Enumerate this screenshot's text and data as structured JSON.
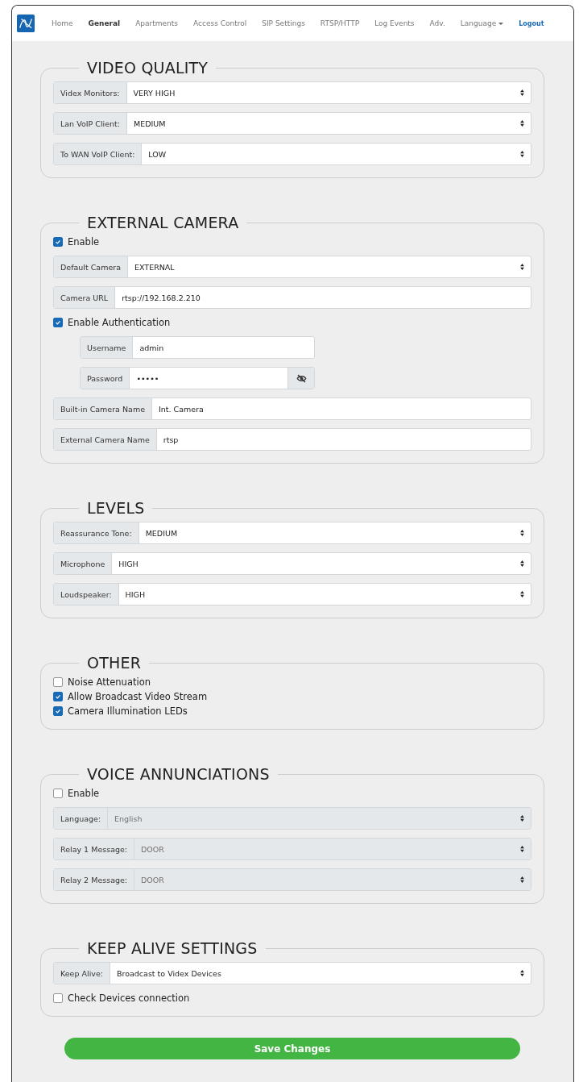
{
  "nav": {
    "items": [
      {
        "label": "Home",
        "selected": false,
        "kind": "link"
      },
      {
        "label": "General",
        "selected": true,
        "kind": "link"
      },
      {
        "label": "Apartments",
        "selected": false,
        "kind": "link"
      },
      {
        "label": "Access Control",
        "selected": false,
        "kind": "link"
      },
      {
        "label": "SIP Settings",
        "selected": false,
        "kind": "link"
      },
      {
        "label": "RTSP/HTTP",
        "selected": false,
        "kind": "link"
      },
      {
        "label": "Log Events",
        "selected": false,
        "kind": "link"
      },
      {
        "label": "Adv.",
        "selected": false,
        "kind": "link"
      },
      {
        "label": "Language",
        "selected": false,
        "kind": "dropdown"
      },
      {
        "label": "Logout",
        "selected": false,
        "kind": "logout"
      }
    ]
  },
  "sections": [
    {
      "title": "VIDEO QUALITY",
      "items": [
        {
          "kind": "select",
          "label": "Videx Monitors:",
          "value": "VERY HIGH",
          "disabled": false
        },
        {
          "kind": "select",
          "label": "Lan VoIP Client:",
          "value": "MEDIUM",
          "disabled": false
        },
        {
          "kind": "select",
          "label": "To WAN VoIP Client:",
          "value": "LOW",
          "disabled": false
        }
      ]
    },
    {
      "title": "EXTERNAL CAMERA",
      "items": [
        {
          "kind": "checkbox",
          "label": "Enable",
          "checked": true
        },
        {
          "kind": "select",
          "label": "Default Camera",
          "value": "EXTERNAL",
          "disabled": false
        },
        {
          "kind": "input",
          "label": "Camera URL",
          "value": "rtsp://192.168.2.210"
        },
        {
          "kind": "checkbox",
          "label": "Enable Authentication",
          "checked": true,
          "children": [
            {
              "kind": "input",
              "label": "Username",
              "value": "admin"
            },
            {
              "kind": "password",
              "label": "Password",
              "value": "•••••"
            }
          ]
        },
        {
          "kind": "input",
          "label": "Built-in Camera Name",
          "value": "Int. Camera"
        },
        {
          "kind": "input",
          "label": "External Camera Name",
          "value": "rtsp"
        }
      ]
    },
    {
      "title": "LEVELS",
      "items": [
        {
          "kind": "select",
          "label": "Reassurance Tone:",
          "value": "MEDIUM",
          "disabled": false
        },
        {
          "kind": "select",
          "label": "Microphone",
          "value": "HIGH",
          "disabled": false
        },
        {
          "kind": "select",
          "label": "Loudspeaker:",
          "value": "HIGH",
          "disabled": false
        }
      ]
    },
    {
      "title": "OTHER",
      "items": [
        {
          "kind": "checkbox",
          "label": "Noise Attenuation",
          "checked": false
        },
        {
          "kind": "checkbox",
          "label": "Allow Broadcast Video Stream",
          "checked": true
        },
        {
          "kind": "checkbox",
          "label": "Camera Illumination LEDs",
          "checked": true
        }
      ]
    },
    {
      "title": "VOICE ANNUNCIATIONS",
      "items": [
        {
          "kind": "checkbox",
          "label": "Enable",
          "checked": false
        },
        {
          "kind": "select",
          "label": "Language:",
          "value": "English",
          "disabled": true
        },
        {
          "kind": "select",
          "label": "Relay 1 Message:",
          "value": "DOOR",
          "disabled": true
        },
        {
          "kind": "select",
          "label": "Relay 2 Message:",
          "value": "DOOR",
          "disabled": true
        }
      ]
    },
    {
      "title": "KEEP ALIVE SETTINGS",
      "items": [
        {
          "kind": "select",
          "label": "Keep Alive:",
          "value": "Broadcast to Videx Devices",
          "disabled": false
        },
        {
          "kind": "checkbox",
          "label": "Check Devices connection",
          "checked": false
        }
      ]
    }
  ],
  "save_button": "Save Changes"
}
